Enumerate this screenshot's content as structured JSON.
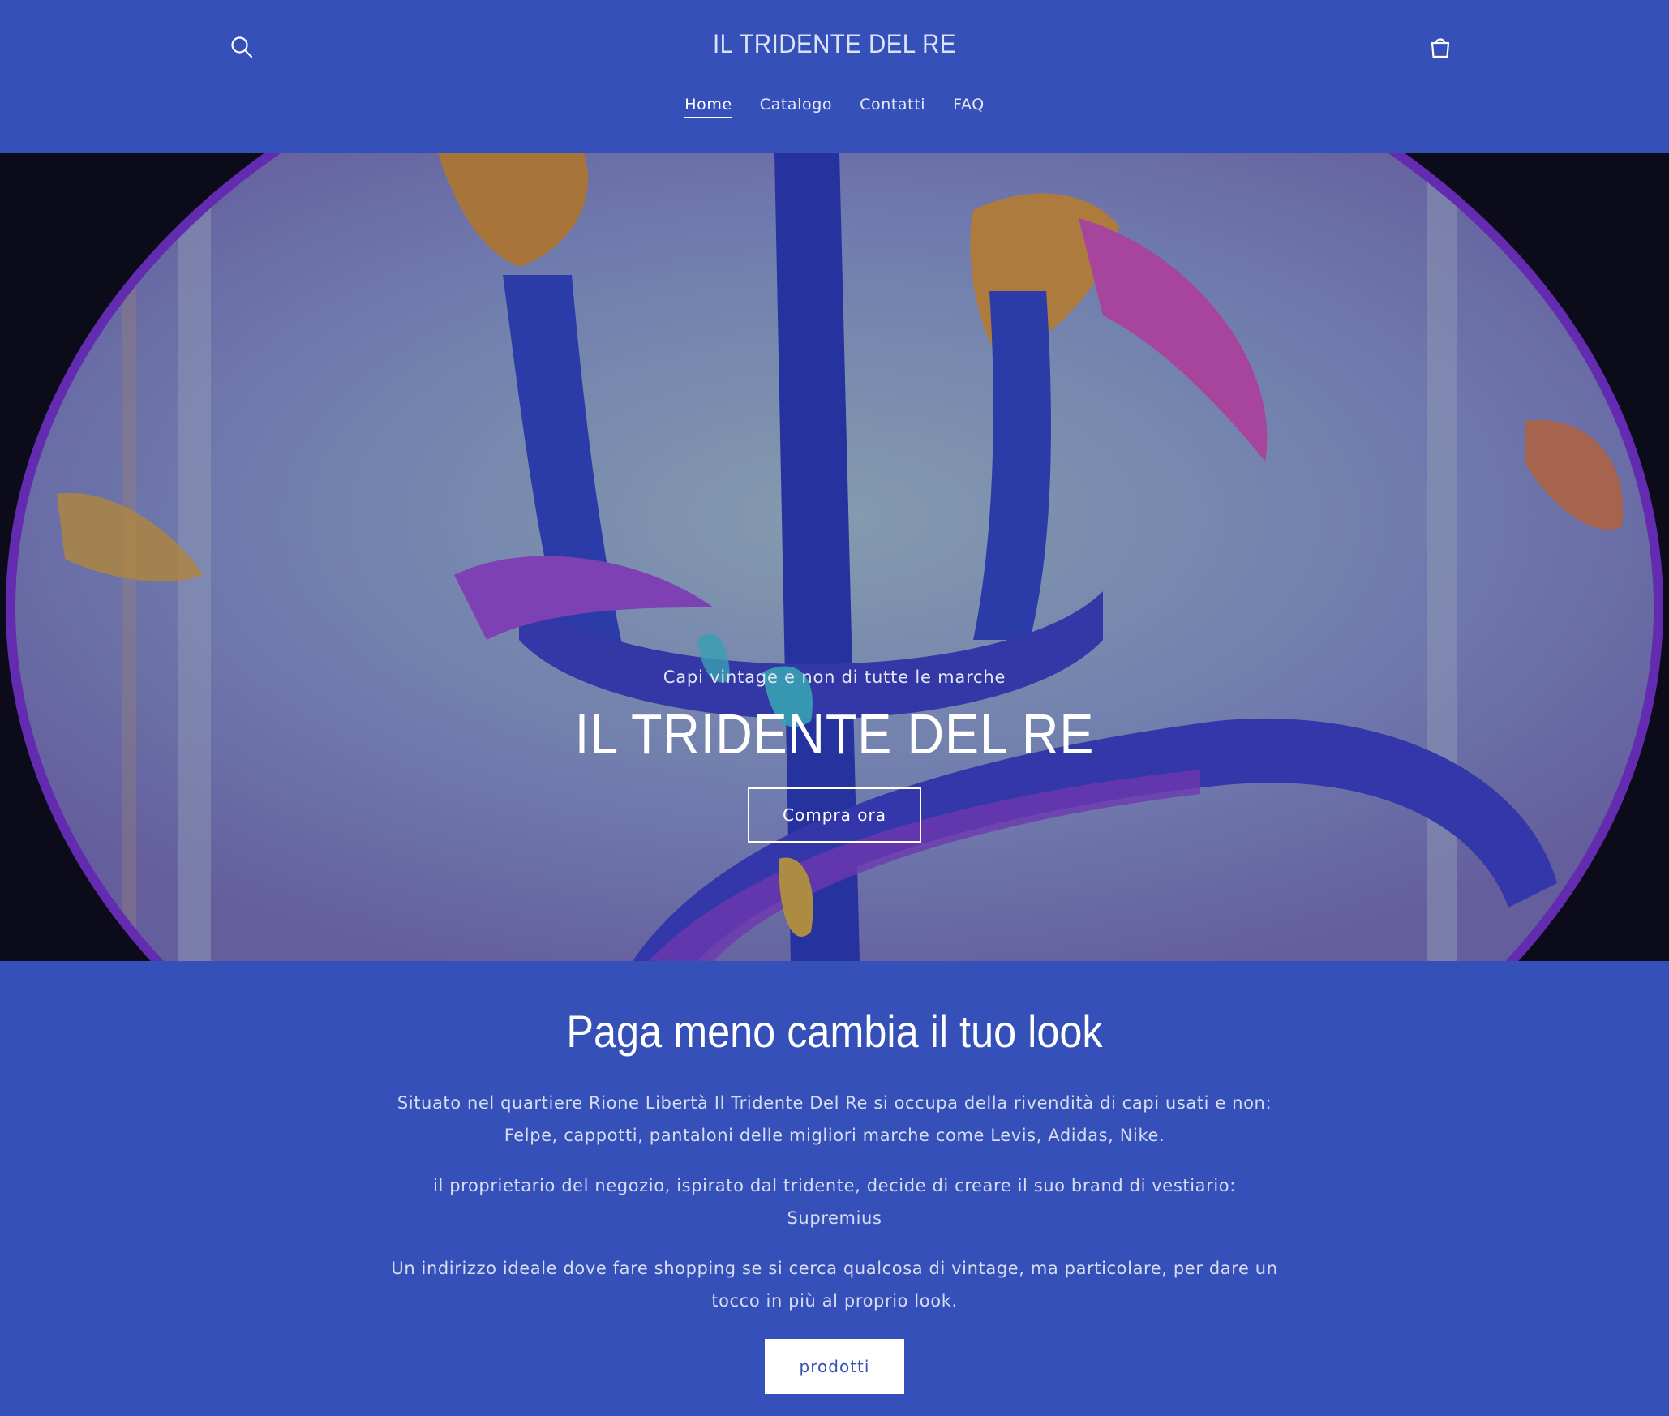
{
  "header": {
    "site_title": "IL TRIDENTE DEL RE",
    "search_icon": "search-icon",
    "cart_icon": "cart-icon",
    "nav": [
      {
        "label": "Home",
        "active": true
      },
      {
        "label": "Catalogo",
        "active": false
      },
      {
        "label": "Contatti",
        "active": false
      },
      {
        "label": "FAQ",
        "active": false
      }
    ]
  },
  "hero": {
    "subtitle": "Capi vintage e non di tutte le marche",
    "title": "IL TRIDENTE DEL RE",
    "button_label": "Compra ora"
  },
  "about": {
    "heading": "Paga meno cambia il tuo look",
    "paragraphs": [
      "Situato nel quartiere Rione Libertà Il Tridente Del Re si occupa della rivendità di capi usati e non: Felpe, cappotti, pantaloni delle migliori marche come Levis, Adidas, Nike.",
      "il proprietario del negozio, ispirato dal tridente, decide di creare il suo brand di vestiario: Supremius",
      "Un indirizzo ideale dove fare shopping se si cerca qualcosa di vintage, ma particolare, per dare un tocco in più al proprio look."
    ],
    "button_label": "prodotti"
  },
  "colors": {
    "brand_blue": "#3550b8",
    "white": "#ffffff"
  }
}
